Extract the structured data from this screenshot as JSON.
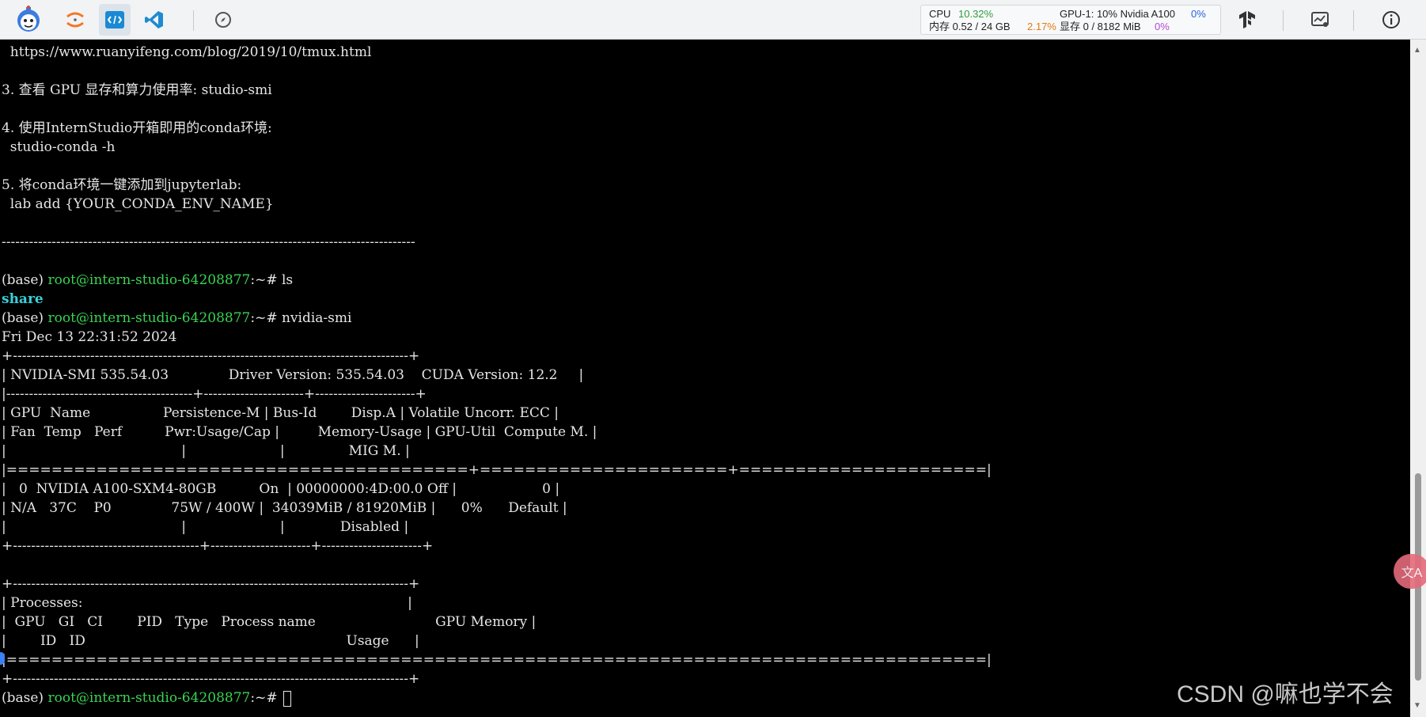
{
  "toolbar": {
    "stats": {
      "cpu_label": "CPU",
      "cpu_value": "10.32%",
      "gpu_label": "GPU-1: 10% Nvidia A100",
      "gpu_value": "0%",
      "mem_label": "内存 0.52 / 24 GB",
      "mem_value": "2.17%",
      "vram_label": "显存 0 / 8182 MiB",
      "vram_value": "0%"
    },
    "colors": {
      "good": "#2e9d3c",
      "warn": "#e07b14",
      "info": "#2a62d8",
      "accent": "#b34ad6"
    }
  },
  "terminal": {
    "lines": [
      "  https://www.ruanyifeng.com/blog/2019/10/tmux.html",
      "",
      "3. 查看 GPU 显存和算力使用率: studio-smi",
      "",
      "4. 使用InternStudio开箱即用的conda环境:",
      "  studio-conda -h",
      "",
      "5. 将conda环境一键添加到jupyterlab:",
      "  lab add {YOUR_CONDA_ENV_NAME}",
      "",
      "-------------------------------------------------------------------------------------------",
      "",
      "",
      "(base) root@intern-studio-64208877:~# ls",
      "share",
      "(base) root@intern-studio-64208877:~# nvidia-smi",
      "Fri Dec 13 22:31:52 2024",
      "+---------------------------------------------------------------------------------------+",
      "| NVIDIA-SMI 535.54.03              Driver Version: 535.54.03    CUDA Version: 12.2     |",
      "|-----------------------------------------+----------------------+----------------------+",
      "| GPU  Name                 Persistence-M | Bus-Id        Disp.A | Volatile Uncorr. ECC |",
      "| Fan  Temp   Perf          Pwr:Usage/Cap |         Memory-Usage | GPU-Util  Compute M. |",
      "|                                         |                      |               MIG M. |",
      "|=========================================+======================+======================|",
      "|   0  NVIDIA A100-SXM4-80GB          On  | 00000000:4D:00.0 Off |                    0 |",
      "| N/A   37C    P0              75W / 400W |  34039MiB / 81920MiB |      0%      Default |",
      "|                                         |                      |             Disabled |",
      "+-----------------------------------------+----------------------+----------------------+",
      "",
      "",
      "+---------------------------------------------------------------------------------------+",
      "| Processes:                                                                            |",
      "|  GPU   GI   CI        PID   Type   Process name                            GPU Memory |",
      "|        ID   ID                                                             Usage      |",
      "|=======================================================================================|",
      "+---------------------------------------------------------------------------------------+"
    ],
    "prompt": {
      "prefix": "(base) ",
      "user_host": "root@intern-studio-64208877",
      "suffix": ":~# "
    },
    "colors": {
      "background": "#000000",
      "text": "#e6e6e6",
      "prompt_user": "#39d353",
      "directory": "#39d0d8"
    }
  },
  "overlay": {
    "translate_icon": "translate-icon",
    "translate_label": "文A",
    "watermark": "CSDN @嘛也学不会"
  }
}
